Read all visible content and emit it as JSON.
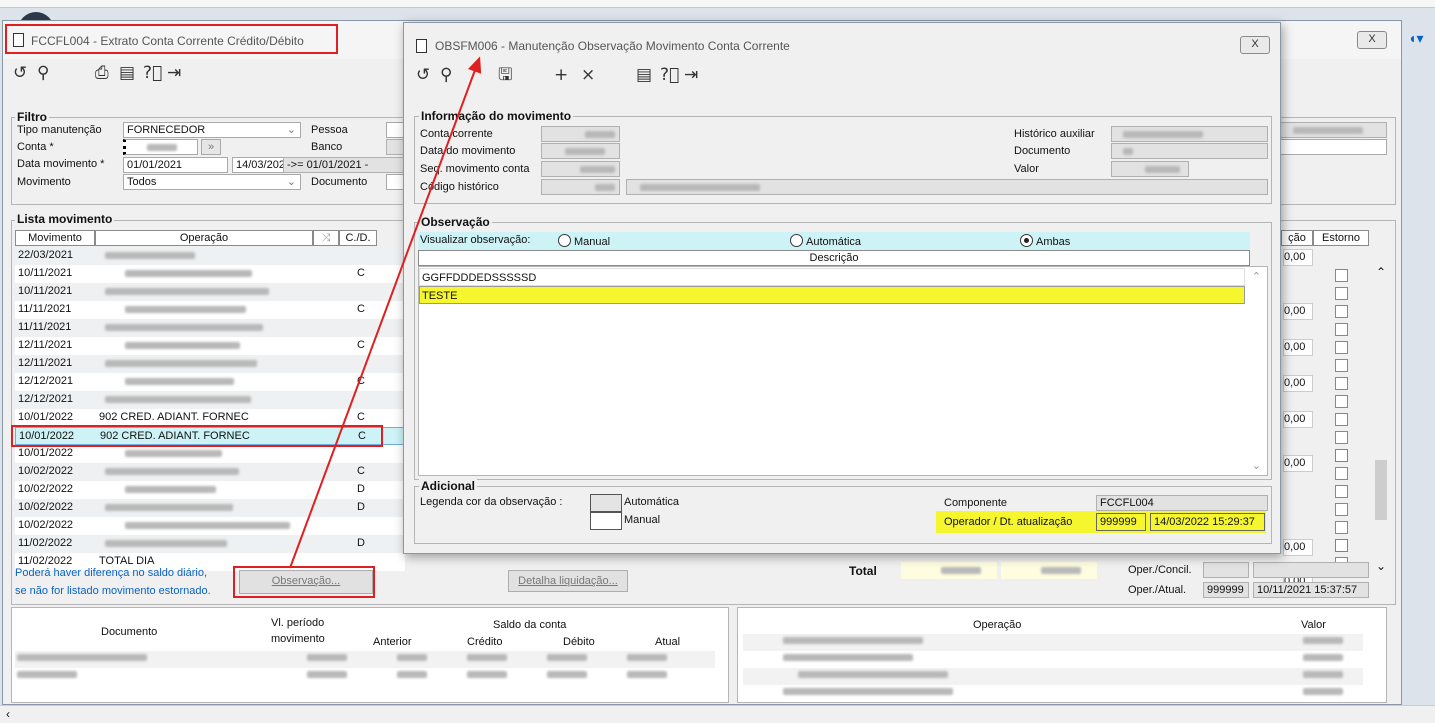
{
  "main": {
    "title": "FCCFL004 - Extrato Conta Corrente Crédito/Débito",
    "close_label": "X",
    "filter": {
      "group_label": "Filtro",
      "tipo_label": "Tipo manutenção",
      "tipo_value": "FORNECEDOR",
      "pessoa_label": "Pessoa",
      "conta_label": "Conta *",
      "banco_label": "Banco",
      "data_label": "Data movimento *",
      "data_from": "01/01/2021",
      "data_to": "14/03/2022",
      "data_hint": "->= 01/01/2021 -",
      "mov_label": "Movimento",
      "mov_value": "Todos",
      "doc_label": "Documento"
    },
    "lista": {
      "group_label": "Lista movimento",
      "headers": {
        "movimento": "Movimento",
        "operacao": "Operação",
        "cd": "C./D.",
        "acao": "ção",
        "estorno": "Estorno"
      },
      "rows": [
        {
          "date": "22/03/2021",
          "op": "",
          "cd": ""
        },
        {
          "date": "10/11/2021",
          "op": "",
          "cd": "C"
        },
        {
          "date": "10/11/2021",
          "op": "",
          "cd": ""
        },
        {
          "date": "11/11/2021",
          "op": "",
          "cd": "C"
        },
        {
          "date": "11/11/2021",
          "op": "",
          "cd": ""
        },
        {
          "date": "12/11/2021",
          "op": "",
          "cd": "C"
        },
        {
          "date": "12/11/2021",
          "op": "",
          "cd": ""
        },
        {
          "date": "12/12/2021",
          "op": "",
          "cd": "C"
        },
        {
          "date": "12/12/2021",
          "op": "",
          "cd": ""
        },
        {
          "date": "10/01/2022",
          "op": "902 CRED. ADIANT. FORNEC",
          "cd": "C"
        },
        {
          "date": "10/01/2022",
          "op": "902 CRED. ADIANT. FORNEC",
          "cd": "C"
        },
        {
          "date": "10/01/2022",
          "op": "",
          "cd": ""
        },
        {
          "date": "10/02/2022",
          "op": "",
          "cd": "C"
        },
        {
          "date": "10/02/2022",
          "op": "",
          "cd": "D"
        },
        {
          "date": "10/02/2022",
          "op": "",
          "cd": "D"
        },
        {
          "date": "10/02/2022",
          "op": "",
          "cd": ""
        },
        {
          "date": "11/02/2022",
          "op": "",
          "cd": "D"
        },
        {
          "date": "11/02/2022",
          "op": "TOTAL DIA",
          "cd": ""
        }
      ],
      "right_values": [
        "0,00",
        "0,00",
        "0,00",
        "0,00",
        "0,00",
        "0,00",
        "0,00",
        "0,00"
      ],
      "warning_line1": "Poderá haver diferença no saldo diário,",
      "warning_line2": "se não for listado movimento estornado.",
      "observacao_button": "Observação...",
      "detalha_button": "Detalha liquidação...",
      "total_label": "Total",
      "oper_concil_label": "Oper./Concil.",
      "oper_atual_label": "Oper./Atual.",
      "oper_atual_code": "999999",
      "oper_atual_date": "10/11/2021 15:37:57"
    },
    "bottom": {
      "documento": "Documento",
      "vl_periodo": "Vl. período",
      "movimento": "movimento",
      "saldo_conta": "Saldo da conta",
      "anterior": "Anterior",
      "credito": "Crédito",
      "debito": "Débito",
      "atual": "Atual",
      "operacao": "Operação",
      "valor": "Valor"
    }
  },
  "dialog": {
    "title": "OBSFM006 - Manutenção Observação Movimento Conta Corrente",
    "close_label": "X",
    "info": {
      "group_label": "Informação do movimento",
      "conta_label": "Conta corrente",
      "data_label": "Data do movimento",
      "seq_label": "Seq. movimento conta",
      "codigo_label": "Código histórico",
      "hist_aux_label": "Histórico auxiliar",
      "documento_label": "Documento",
      "valor_label": "Valor"
    },
    "obs": {
      "group_label": "Observação",
      "visualizar_label": "Visualizar observação:",
      "opt_manual": "Manual",
      "opt_auto": "Automática",
      "opt_ambas": "Ambas",
      "selected": "Ambas",
      "col_descricao": "Descrição",
      "rows": [
        "GGFFDDDEDSSSSSD",
        "TESTE"
      ]
    },
    "adicional": {
      "group_label": "Adicional",
      "legenda_label": "Legenda cor da observação :",
      "leg_auto": "Automática",
      "leg_manual": "Manual",
      "componente_label": "Componente",
      "componente_value": "FCCFL004",
      "operador_label": "Operador / Dt. atualização",
      "operador_code": "999999",
      "operador_date": "14/03/2022 15:29:37"
    }
  },
  "colors": {
    "highlight_yellow": "#f6f62f",
    "selected_cyan": "#cdf3f7",
    "annotation_red": "#e02020"
  }
}
